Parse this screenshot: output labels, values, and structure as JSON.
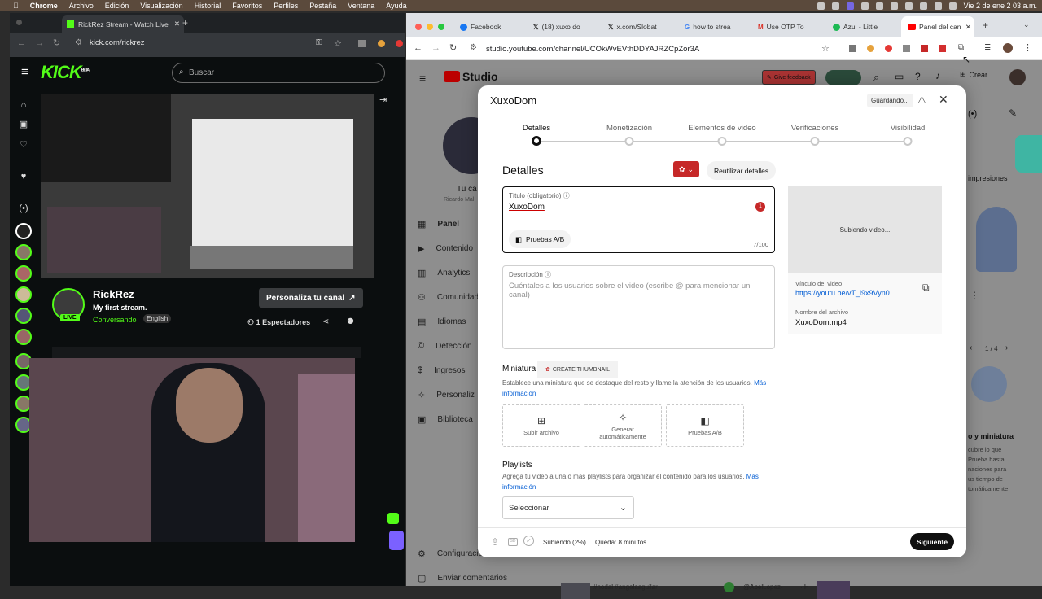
{
  "menubar": {
    "apple": "",
    "app": "Chrome",
    "items": [
      "Archivo",
      "Edición",
      "Visualización",
      "Historial",
      "Favoritos",
      "Perfiles",
      "Pestaña",
      "Ventana",
      "Ayuda"
    ],
    "clock": "Vie 2 de ene  2 03 a.m."
  },
  "kick": {
    "tab_title": "RickRez Stream - Watch Live",
    "url": "kick.com/rickrez",
    "logo": "KICK",
    "logo_beta": "BETA",
    "search_placeholder": "Buscar",
    "channel": {
      "name": "RickRez",
      "title": "My first stream.",
      "category": "Conversando",
      "language": "English",
      "live": "LIVE",
      "customize": "Personaliza tu canal",
      "viewers": "1 Espectadores"
    }
  },
  "yt": {
    "tabs": [
      "Facebook",
      "(18) xuxo do",
      "x.com/Slobat",
      "how to strea",
      "Use OTP To",
      "Azul - Little",
      "Panel del can"
    ],
    "url": "studio.youtube.com/channel/UCOkWvEVthDDYAJRZCpZor3A",
    "studio_logo": "Studio",
    "feedback": "Give feedback",
    "create": "Crear",
    "channel_short": "Tu ca",
    "channel_sub": "Ricardo Mal",
    "nav": [
      "Panel",
      "Contenido",
      "Analytics",
      "Comunidad",
      "Idiomas",
      "Detección",
      "Ingresos",
      "Personaliz",
      "Biblioteca"
    ],
    "nav_bottom": [
      "Configuración",
      "Enviar comentarios"
    ],
    "right_texts": {
      "impresiones": "impresiones",
      "pager": "1 / 4",
      "miniatura": "o y miniatura",
      "lines": [
        "cubre lo que",
        "Prueba hasta",
        "naciones para",
        "us tiempo de",
        "tomáticamente"
      ]
    },
    "bottom": [
      "#nodal #angelaaguilar",
      "@AbelLopez-",
      "· H"
    ]
  },
  "modal": {
    "title": "XuxoDom",
    "saving": "Guardando...",
    "steps": [
      "Detalles",
      "Monetización",
      "Elementos de video",
      "Verificaciones",
      "Visibilidad"
    ],
    "heading": "Detalles",
    "reuse": "Reutilizar detalles",
    "title_label": "Título (obligatorio)",
    "title_value": "XuxoDom",
    "title_badge": "1",
    "ab_button": "Pruebas A/B",
    "title_count": "7/100",
    "desc_label": "Descripción",
    "desc_placeholder": "Cuéntales a los usuarios sobre el video (escribe @ para mencionar un canal)",
    "uploading": "Subiendo video...",
    "link_label": "Vínculo del video",
    "link": "https://youtu.be/vT_l9x9Vyn0",
    "file_label": "Nombre del archivo",
    "file": "XuxoDom.mp4",
    "thumb_heading": "Miniatura",
    "create_thumb": "CREATE THUMBNAIL",
    "thumb_desc": "Establece una miniatura que se destaque del resto y llame la atención de los usuarios.",
    "thumb_more": "Más",
    "thumb_more2": "información",
    "thumb_opts": [
      "Subir archivo",
      "Generar automáticamente",
      "Pruebas A/B"
    ],
    "playlists_heading": "Playlists",
    "playlists_desc": "Agrega tu video a una o más playlists para organizar el contenido para los usuarios.",
    "playlists_more": "Más",
    "playlists_more2": "información",
    "select": "Seleccionar",
    "status": "Subiendo (2%) ... Queda: 8 minutos",
    "next": "Siguiente"
  },
  "colors": {
    "kick_green": "#53fc18",
    "yt_red": "#ff0000",
    "link_blue": "#065fd4"
  }
}
